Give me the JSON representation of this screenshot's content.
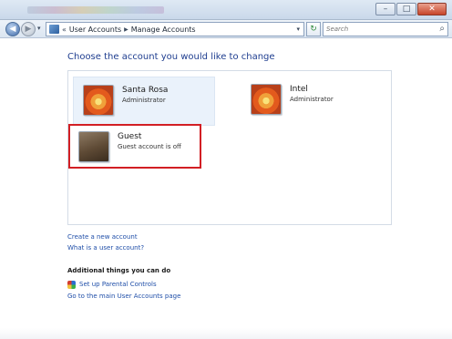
{
  "address": {
    "breadcrumb": [
      "User Accounts",
      "Manage Accounts"
    ],
    "chevron": "«"
  },
  "search": {
    "placeholder": "Search"
  },
  "content": {
    "heading": "Choose the account you would like to change",
    "accounts": [
      {
        "name": "Santa Rosa",
        "role": "Administrator",
        "avatar": "flower-avatar"
      },
      {
        "name": "Intel",
        "role": "Administrator",
        "avatar": "flower-avatar"
      },
      {
        "name": "Guest",
        "role": "Guest account is off",
        "avatar": "briefcase-avatar"
      }
    ],
    "links": [
      "Create a new account",
      "What is a user account?"
    ],
    "additional_title": "Additional things you can do",
    "additional_links": [
      "Set up Parental Controls",
      "Go to the main User Accounts page"
    ]
  },
  "colors": {
    "heading": "#1e3d8f",
    "link": "#1f4ea8",
    "highlight_border": "#d21f24",
    "selected_tile": "#eaf2fb"
  }
}
